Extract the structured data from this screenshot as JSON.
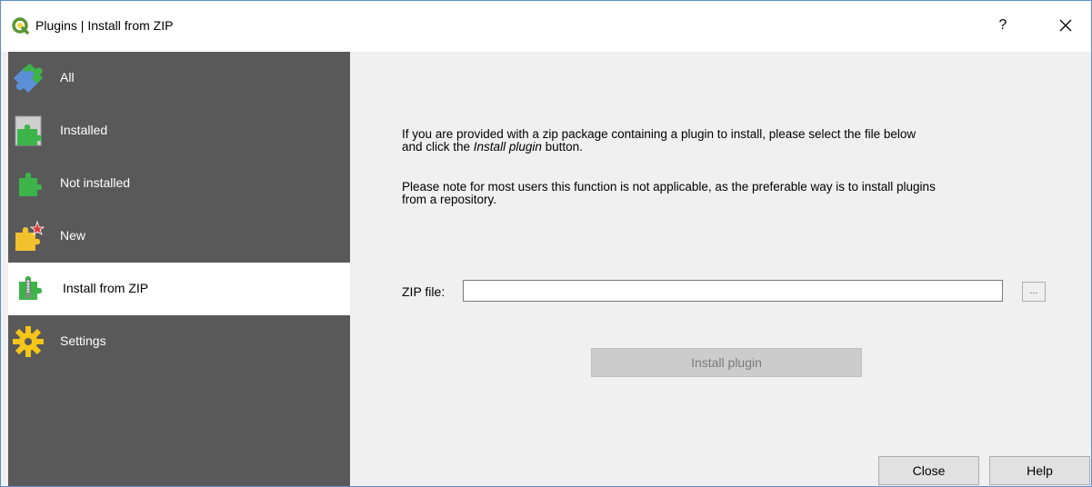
{
  "window": {
    "title": "Plugins | Install from ZIP",
    "help_label": "?",
    "close_label": "✕"
  },
  "sidebar": {
    "items": [
      {
        "label": "All",
        "icon": "puzzle-all-icon"
      },
      {
        "label": "Installed",
        "icon": "puzzle-installed-icon"
      },
      {
        "label": "Not installed",
        "icon": "puzzle-not-installed-icon"
      },
      {
        "label": "New",
        "icon": "puzzle-new-icon"
      },
      {
        "label": "Install from ZIP",
        "icon": "puzzle-zip-icon",
        "selected": true
      },
      {
        "label": "Settings",
        "icon": "gear-icon"
      }
    ]
  },
  "content": {
    "para1_line1": "If you are provided with a zip package containing a plugin to install, please select the file below",
    "para1_pre": "and click the ",
    "para1_em": "Install plugin",
    "para1_post": " button.",
    "para2_line1": "Please note for most users this function is not applicable, as the preferable way is to install plugins",
    "para2_line2": "from a repository.",
    "zip_label": "ZIP file:",
    "zip_value": "",
    "browse_label": "...",
    "install_label": "Install plugin"
  },
  "buttons": {
    "close_label": "Close",
    "help_label": "Help"
  },
  "colors": {
    "sidebar_bg": "#595959",
    "selected_bg": "#ffffff",
    "window_border": "#5a8fd0",
    "puzzle_green": "#3cb44a",
    "qgis_green": "#589632"
  }
}
